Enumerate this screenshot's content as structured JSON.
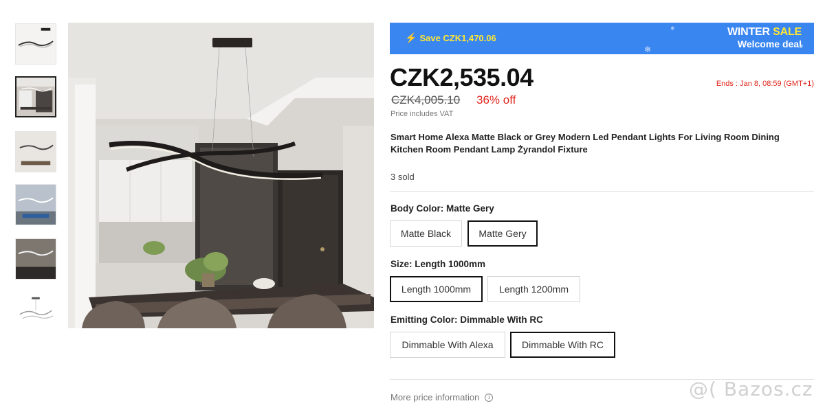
{
  "gallery": {
    "thumbnails": [
      {
        "name": "thumbnail-1"
      },
      {
        "name": "thumbnail-2",
        "selected": true
      },
      {
        "name": "thumbnail-3"
      },
      {
        "name": "thumbnail-4"
      },
      {
        "name": "thumbnail-5"
      },
      {
        "name": "thumbnail-6"
      }
    ]
  },
  "banner": {
    "save_text": "Save CZK1,470.06",
    "bolt_icon": "lightning-bolt-icon",
    "sale_title_main": "WINTER ",
    "sale_title_accent": "SALE",
    "sale_subtitle": "Welcome deal",
    "bg_color": "#3a86f0",
    "accent_color": "#ffe733"
  },
  "pricing": {
    "price": "CZK2,535.04",
    "ends": "Ends :  Jan 8, 08:59 (GMT+1)",
    "old_price": "CZK4,005.10",
    "discount": "36% off",
    "vat_note": "Price includes VAT"
  },
  "product": {
    "title": "Smart Home Alexa Matte Black or Grey Modern Led Pendant Lights For Living Room Dining Kitchen Room Pendant Lamp Żyrandol Fixture",
    "sold": "3 sold"
  },
  "options": {
    "body_color": {
      "label": "Body Color: Matte Gery",
      "values": [
        "Matte Black",
        "Matte Gery"
      ],
      "selected": "Matte Gery"
    },
    "size": {
      "label": "Size: Length 1000mm",
      "values": [
        "Length 1000mm",
        "Length 1200mm"
      ],
      "selected": "Length 1000mm"
    },
    "emitting_color": {
      "label": "Emitting Color: Dimmable With RC",
      "values": [
        "Dimmable With Alexa",
        "Dimmable With RC"
      ],
      "selected": "Dimmable With RC"
    }
  },
  "footer": {
    "more_price_info": "More price information",
    "info_icon": "info-icon",
    "watermark": "@( Bazos.cz"
  }
}
